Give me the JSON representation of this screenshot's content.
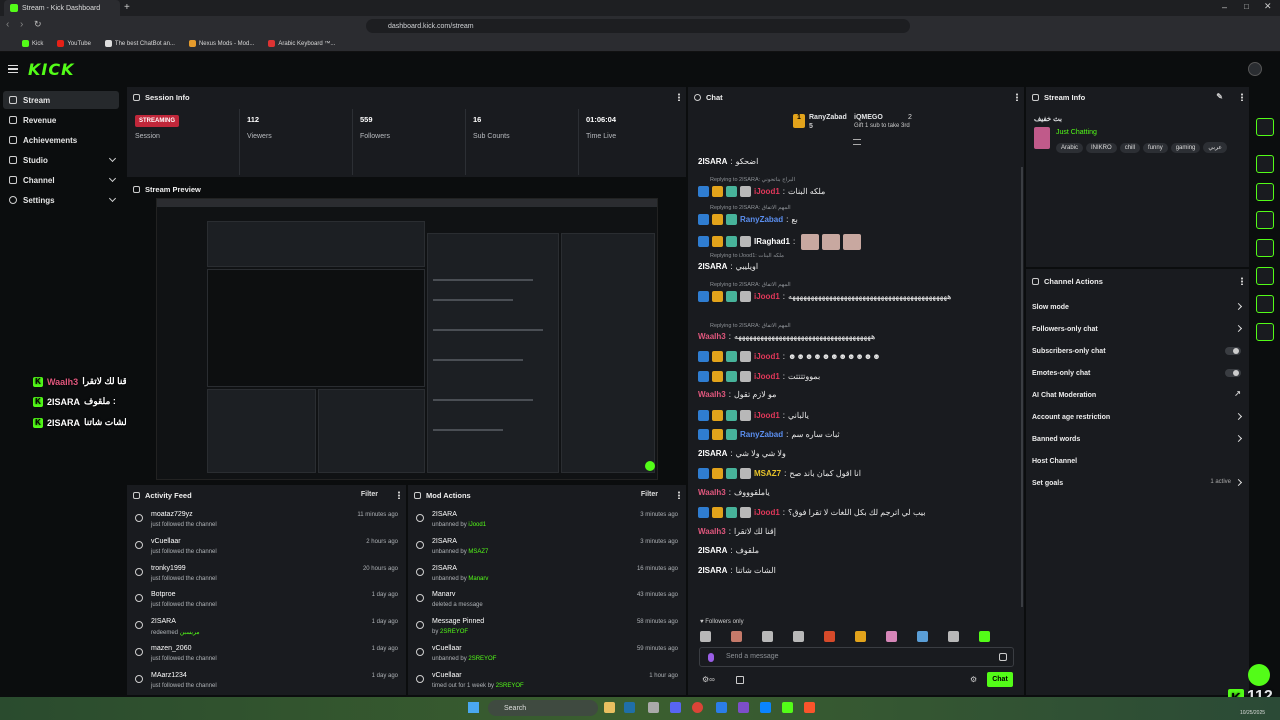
{
  "browser": {
    "tab_title": "Stream - Kick Dashboard",
    "url": "dashboard.kick.com/stream",
    "bookmarks": [
      "Kick",
      "YouTube",
      "The best ChatBot an...",
      "Nexus Mods - Mod...",
      "Arabic Keyboard ™..."
    ]
  },
  "header": {
    "logo": "KICK"
  },
  "sidebar": {
    "items": [
      {
        "label": "Stream",
        "icon": "stream-icon",
        "active": true
      },
      {
        "label": "Revenue",
        "icon": "revenue-icon"
      },
      {
        "label": "Achievements",
        "icon": "trophy-icon"
      },
      {
        "label": "Studio",
        "icon": "studio-icon",
        "expandable": true
      },
      {
        "label": "Channel",
        "icon": "channel-icon",
        "expandable": true
      },
      {
        "label": "Settings",
        "icon": "gear-icon",
        "expandable": true
      }
    ]
  },
  "session": {
    "title": "Session Info",
    "status": "STREAMING",
    "status_label": "Session",
    "viewers": "112",
    "viewers_label": "Viewers",
    "followers": "559",
    "followers_label": "Followers",
    "subs": "16",
    "subs_label": "Sub Counts",
    "time": "01:06:04",
    "time_label": "Time Live"
  },
  "preview": {
    "title": "Stream Preview"
  },
  "overlay": [
    {
      "name": "Waalh3",
      "text": "إقنا لك لاتقرا :",
      "color": "#e0577d"
    },
    {
      "name": "2ISARA",
      "text": "ملقوف :",
      "color": "#ffffff"
    },
    {
      "name": "2ISARA",
      "text": "الشات شاتنا :",
      "color": "#ffffff"
    }
  ],
  "activity": {
    "title": "Activity Feed",
    "filter": "Filter",
    "items": [
      {
        "name": "moataz729yz",
        "sub": "just followed the channel",
        "time": "11 minutes ago",
        "icon": "heart-icon"
      },
      {
        "name": "vCuellaar",
        "sub": "just followed the channel",
        "time": "2 hours ago",
        "icon": "heart-icon"
      },
      {
        "name": "tronky1999",
        "sub": "just followed the channel",
        "time": "20 hours ago",
        "icon": "heart-icon"
      },
      {
        "name": "Botproe",
        "sub": "just followed the channel",
        "time": "1 day ago",
        "icon": "heart-icon"
      },
      {
        "name": "2ISARA",
        "sub": "redeemed",
        "sub_green": "مريسبن",
        "time": "1 day ago",
        "icon": "redeem-icon"
      },
      {
        "name": "mazen_2060",
        "sub": "just followed the channel",
        "time": "1 day ago",
        "icon": "heart-icon"
      },
      {
        "name": "MAarz1234",
        "sub": "just followed the channel",
        "time": "1 day ago",
        "icon": "heart-icon"
      }
    ]
  },
  "mod": {
    "title": "Mod Actions",
    "filter": "Filter",
    "items": [
      {
        "name": "2ISARA",
        "sub": "unbanned by",
        "by": "iJood1",
        "time": "3 minutes ago",
        "icon": "undo-icon"
      },
      {
        "name": "2ISARA",
        "sub": "unbanned by",
        "by": "MSAZ7",
        "time": "3 minutes ago",
        "icon": "undo-icon"
      },
      {
        "name": "2ISARA",
        "sub": "unbanned by",
        "by": "Manarv",
        "time": "16 minutes ago",
        "icon": "undo-icon"
      },
      {
        "name": "Manarv",
        "sub": "deleted a message",
        "by": "",
        "time": "43 minutes ago",
        "icon": "trash-icon"
      },
      {
        "name": "Message Pinned",
        "sub": "by",
        "by": "2SREYOF",
        "time": "58 minutes ago",
        "icon": "pin-icon"
      },
      {
        "name": "vCuellaar",
        "sub": "unbanned by",
        "by": "2SREYOF",
        "time": "59 minutes ago",
        "icon": "undo-icon"
      },
      {
        "name": "vCuellaar",
        "sub": "timed out for 1 week by",
        "by": "2SREYOF",
        "time": "1 hour ago",
        "icon": "hourglass-icon"
      }
    ]
  },
  "chat": {
    "title": "Chat",
    "leaders": [
      {
        "name": "RanyZabad",
        "count": "5"
      },
      {
        "name": "iQMEGO",
        "sub": "Gift 1 sub to take 3rd"
      },
      {
        "name": "",
        "count": "2"
      }
    ],
    "messages": [
      {
        "reply": "",
        "user": "2ISARA",
        "color": "#ffffff",
        "text": "اضحكو"
      },
      {
        "reply": "Replying to 2ISARA: البراج بناتحوني",
        "user": "iJood1",
        "color": "#e0385a",
        "text": "ملكه البنات",
        "badges": 4
      },
      {
        "reply": "Replying to 2ISARA: المهم الاتفاق",
        "user": "RanyZabad",
        "color": "#5b8ff0",
        "text": "بع",
        "badges": 3
      },
      {
        "reply": "",
        "user": "lRaghad1",
        "color": "#ffffff",
        "text": "",
        "badges": 4,
        "emotes": 3
      },
      {
        "reply": "Replying to iJood1: ملكه البنات",
        "user": "2ISARA",
        "color": "#ffffff",
        "text": "اويليبي"
      },
      {
        "reply": "Replying to 2ISARA: المهم الاتفاق",
        "user": "iJood1",
        "color": "#e0385a",
        "text": "هههههههههههههههههههههههههههههههههههههههههههه",
        "badges": 4
      },
      {
        "reply": "Replying to 2ISARA: المهم الاتفاق",
        "user": "Waalh3",
        "color": "#e0577d",
        "text": "هههههههههههههههههههههههههههههههههههههه"
      },
      {
        "reply": "",
        "user": "iJood1",
        "color": "#e0385a",
        "text": "☻☻☻☻☻☻☻☻☻☻☻",
        "badges": 4
      },
      {
        "reply": "",
        "user": "iJood1",
        "color": "#e0385a",
        "text": "بمووتتتتت",
        "badges": 4
      },
      {
        "reply": "",
        "user": "Waalh3",
        "color": "#e0577d",
        "text": "مو لازم تقول"
      },
      {
        "reply": "",
        "user": "iJood1",
        "color": "#e0385a",
        "text": "يالباني",
        "badges": 4
      },
      {
        "reply": "",
        "user": "RanyZabad",
        "color": "#5b8ff0",
        "text": "ثبات ساره سم",
        "badges": 3
      },
      {
        "reply": "",
        "user": "2ISARA",
        "color": "#ffffff",
        "text": "ولا شي ولا شي"
      },
      {
        "reply": "",
        "user": "MSAZ7",
        "color": "#e8c42a",
        "text": "انا اقول كمان باند صح",
        "badges": 4
      },
      {
        "reply": "",
        "user": "Waalh3",
        "color": "#e0577d",
        "text": "ياملقوووف"
      },
      {
        "reply": "",
        "user": "iJood1",
        "color": "#e0385a",
        "text": "بيب لي اترجم لك بكل اللغات لا تقرا فوق؟",
        "badges": 4
      },
      {
        "reply": "",
        "user": "Waalh3",
        "color": "#e0577d",
        "text": "إقنا لك لاتقرا"
      },
      {
        "reply": "",
        "user": "2ISARA",
        "color": "#ffffff",
        "text": "ملقوف"
      },
      {
        "reply": "",
        "user": "2ISARA",
        "color": "#ffffff",
        "text": "الشات شاتنا"
      }
    ],
    "followers_only": "Followers only",
    "input_placeholder": "Send a message",
    "send_label": "Chat"
  },
  "stream_info": {
    "title": "Stream Info",
    "stream_title": "بث خفيف",
    "category": "Just Chatting",
    "tags": [
      "Arabic",
      "INIKRO",
      "chill",
      "funny",
      "gaming",
      "عربي"
    ]
  },
  "channel_actions": {
    "title": "Channel Actions",
    "items": [
      {
        "label": "Slow mode",
        "control": "arrow"
      },
      {
        "label": "Followers-only chat",
        "control": "arrow"
      },
      {
        "label": "Subscribers-only chat",
        "control": "toggle"
      },
      {
        "label": "Emotes-only chat",
        "control": "toggle"
      },
      {
        "label": "AI Chat Moderation",
        "control": "external"
      },
      {
        "label": "Account age restriction",
        "control": "arrow"
      },
      {
        "label": "Banned words",
        "control": "arrow"
      },
      {
        "label": "Host Channel",
        "control": "none"
      },
      {
        "label": "Set goals",
        "control": "arrow",
        "extra": "1 active"
      }
    ]
  },
  "corner": {
    "viewer_count": "112"
  },
  "taskbar": {
    "search": "Search",
    "date": "10/25/2025"
  },
  "colors": {
    "accent": "#53fc18",
    "streaming": "#c0273a",
    "panel": "#191b1f",
    "bg": "#0b0d0e"
  }
}
